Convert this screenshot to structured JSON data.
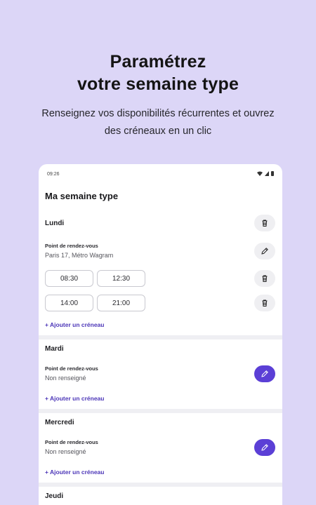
{
  "headline": {
    "line1": "Paramétrez",
    "line2": "votre semaine type"
  },
  "subline": {
    "line1": "Renseignez vos disponibilités récurrentes et ouvrez",
    "line2": "des créneaux en un clic"
  },
  "status": {
    "time": "09:26"
  },
  "screen": {
    "title": "Ma semaine type",
    "meeting_label": "Point de rendez-vous",
    "add_slot_label": "+ Ajouter un créneau",
    "days": [
      {
        "name": "Lundi",
        "meeting_value": "Paris 17, Métro Wagram",
        "slots": [
          {
            "start": "08:30",
            "end": "12:30"
          },
          {
            "start": "14:00",
            "end": "21:00"
          }
        ]
      },
      {
        "name": "Mardi",
        "meeting_value": "Non renseigné"
      },
      {
        "name": "Mercredi",
        "meeting_value": "Non renseigné"
      },
      {
        "name": "Jeudi"
      }
    ]
  },
  "icons": {
    "delete": "trash-icon",
    "edit": "pencil-icon"
  },
  "colors": {
    "background": "#dcd6f7",
    "accent": "#5b3fd6",
    "link": "#4c36b8"
  }
}
